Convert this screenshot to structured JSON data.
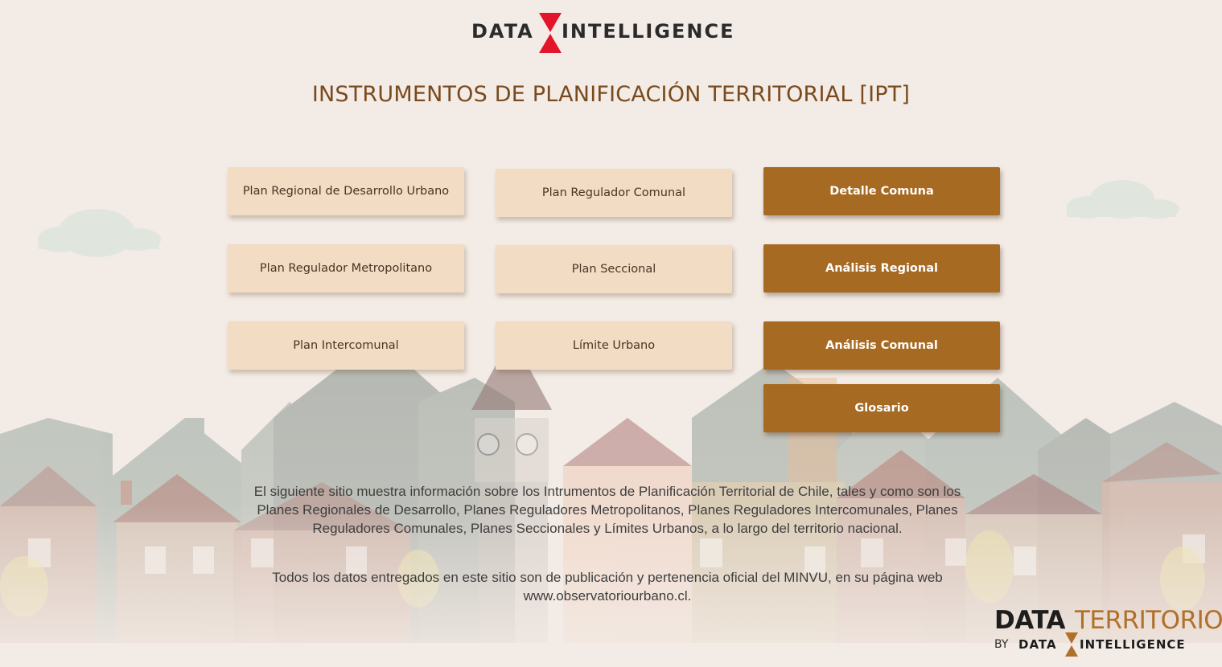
{
  "colors": {
    "background": "#f3ebe5",
    "title": "#7a4a1e",
    "button_light": "#f2dcc3",
    "button_dark": "#a76a22",
    "logo_accent": "#e3152b",
    "territorio": "#b0702a"
  },
  "header": {
    "logo_left": "DATA",
    "logo_right": "INTELLIGENCE",
    "logo_icon": "hourglass-icon"
  },
  "title": "INSTRUMENTOS DE PLANIFICACIÓN TERRITORIAL [IPT]",
  "buttons": {
    "prdu": "Plan Regional de Desarrollo Urbano",
    "prc": "Plan Regulador Comunal",
    "detalle_comuna": "Detalle Comuna",
    "prm": "Plan Regulador Metropolitano",
    "seccional": "Plan Seccional",
    "analisis_regional": "Análisis Regional",
    "intercomunal": "Plan Intercomunal",
    "limite_urbano": "Límite Urbano",
    "analisis_comunal": "Análisis Comunal",
    "glosario": "Glosario"
  },
  "description": {
    "line1": "El siguiente sitio muestra información sobre los Intrumentos de Planificación Territorial de Chile, tales y como son los",
    "line2": "Planes  Regionales de Desarrollo, Planes Reguladores Metropolitanos, Planes Reguladores Intercomunales, Planes",
    "line3": "Reguladores Comunales, Planes Seccionales y Límites Urbanos, a lo largo del territorio nacional.",
    "source1": "Todos los datos entregados en este sitio son de publicación y pertenencia oficial del MINVU, en su página web",
    "source2": "www.observatoriourbano.cl."
  },
  "brand_footer": {
    "data": "DATA",
    "territorio": "TERRITORIO",
    "by": "BY",
    "word_left": "DATA",
    "word_right": "INTELLIGENCE"
  }
}
